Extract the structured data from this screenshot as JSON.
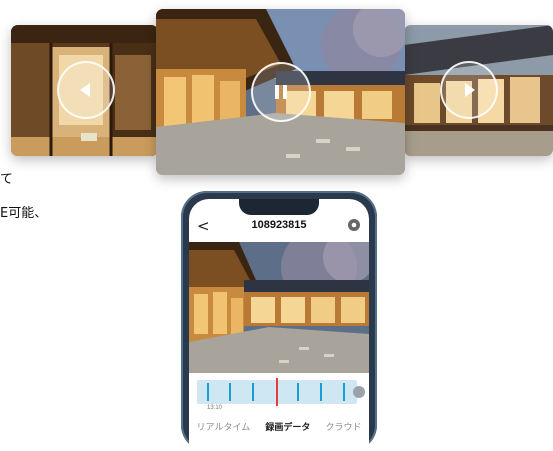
{
  "side_text": {
    "line1": "て",
    "line2": "E可能、"
  },
  "cards": {
    "left": {
      "control": "prev-icon"
    },
    "center": {
      "control": "pause-icon"
    },
    "right": {
      "control": "play-icon"
    }
  },
  "phone": {
    "title": "108923815",
    "back_label": "<",
    "timeline_time": "13:10",
    "tabs": [
      {
        "label": "リアルタイム",
        "active": false
      },
      {
        "label": "録画データ",
        "active": true
      },
      {
        "label": "クラウド",
        "active": false
      }
    ]
  },
  "colors": {
    "accent": "#1a9bd7",
    "timeline_bg": "#cfe6f3",
    "cursor": "#e23c3c",
    "phone_frame": "#2a3a4c"
  }
}
